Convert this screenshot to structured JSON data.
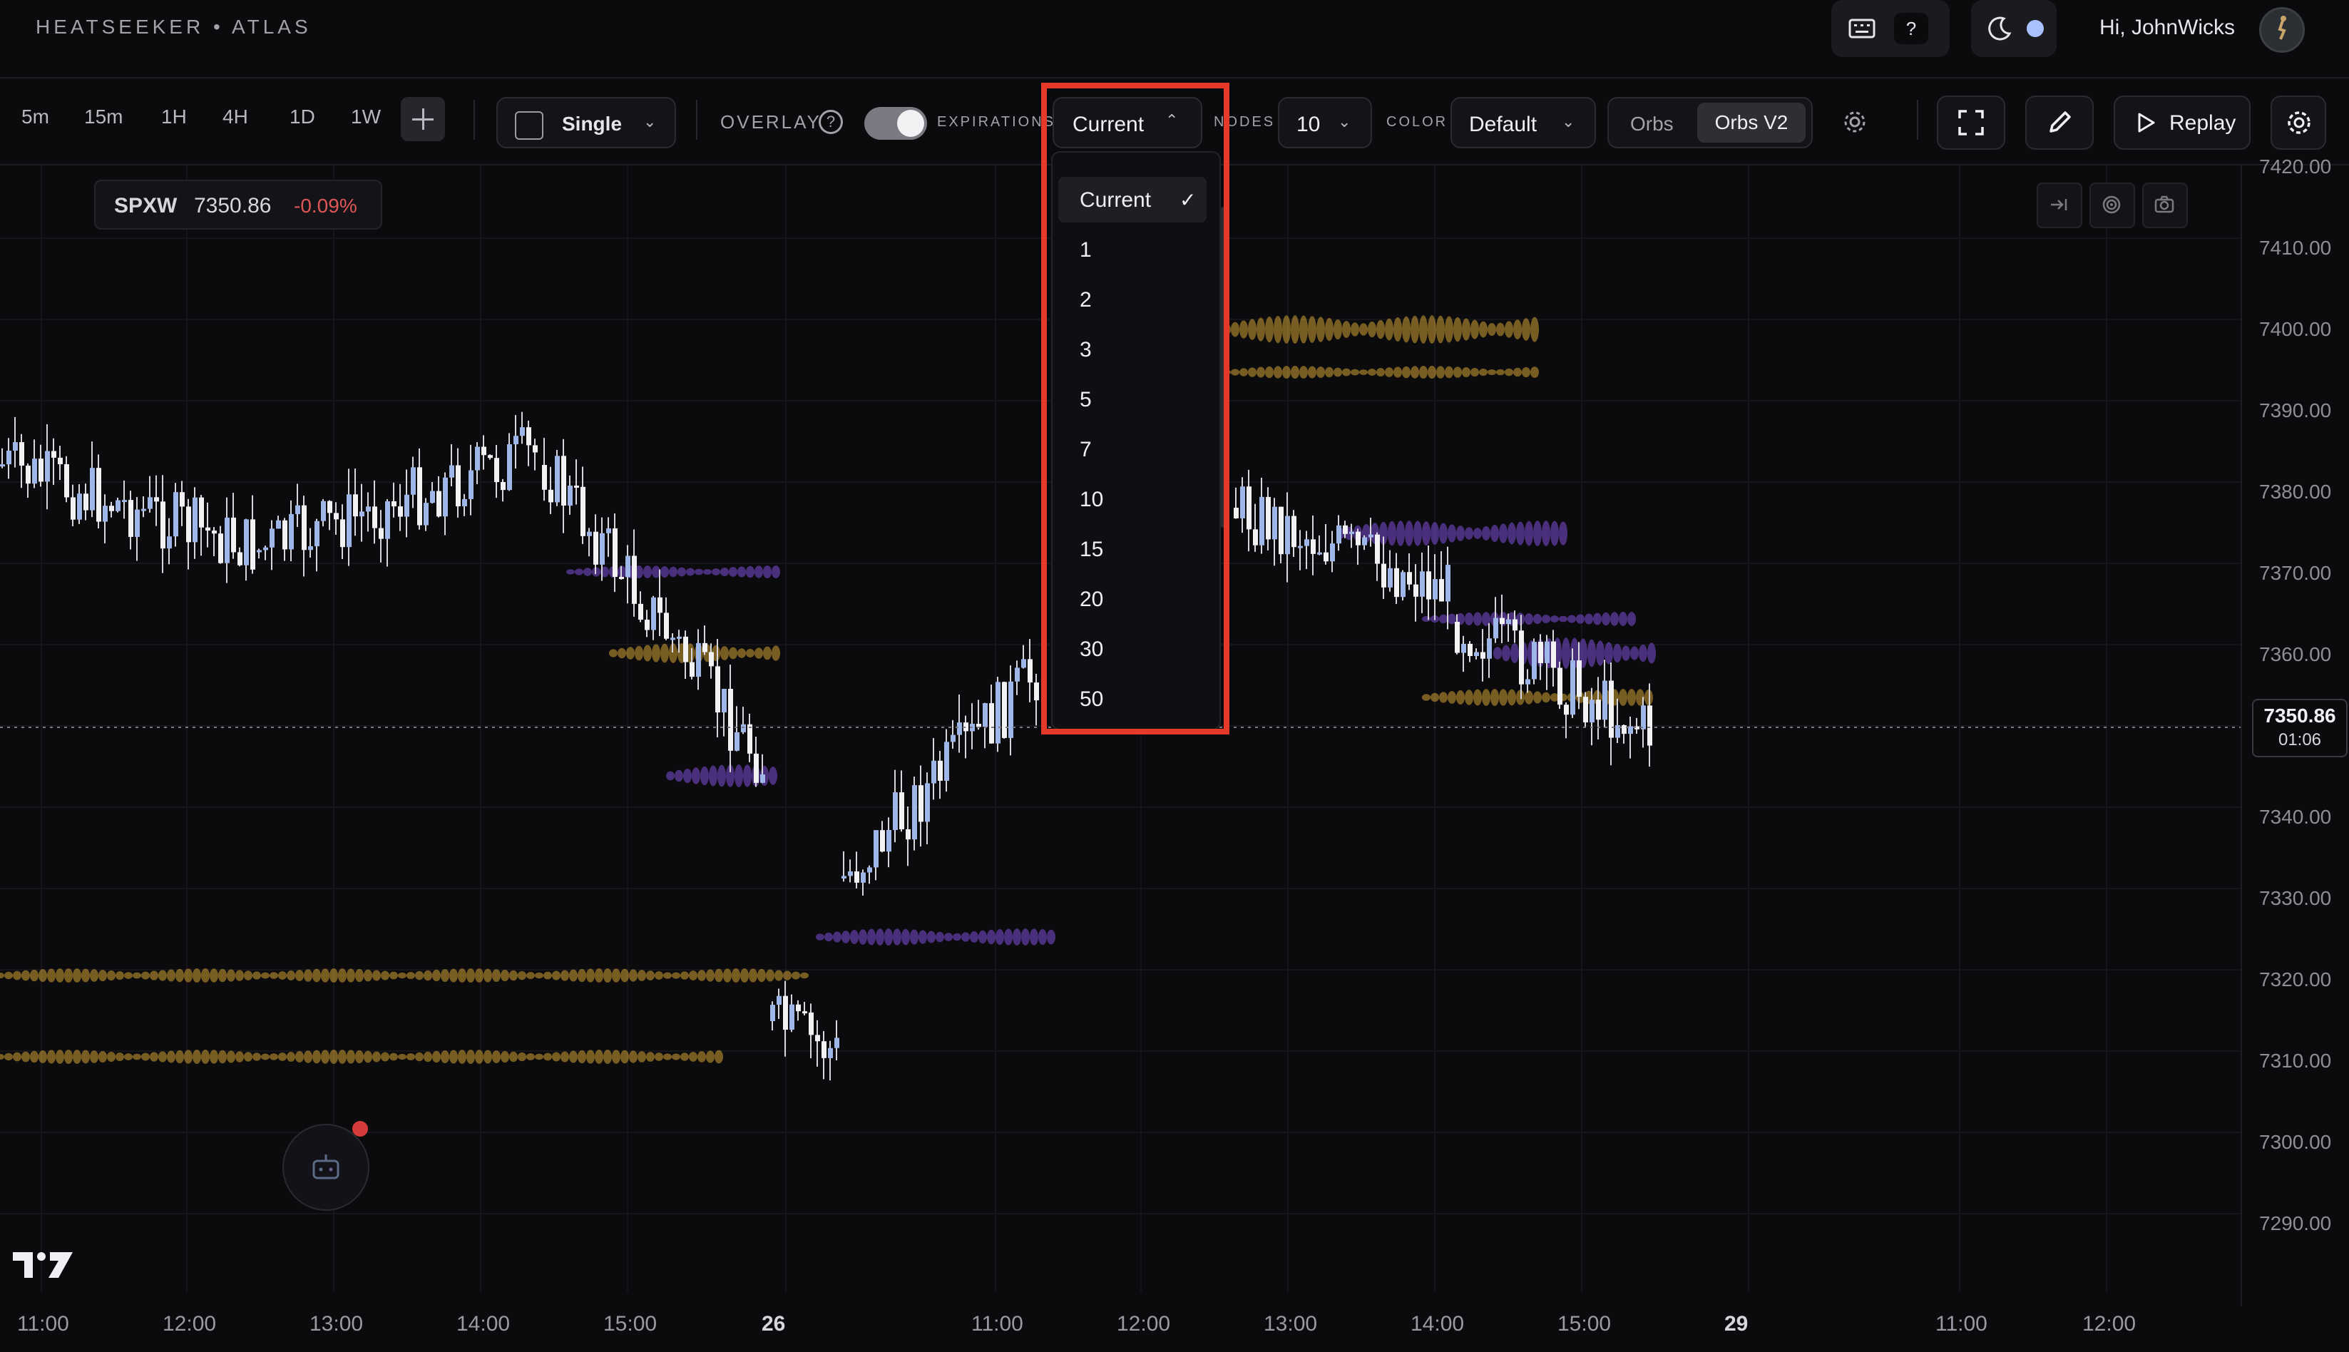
{
  "header": {
    "brand": "HEATSEEKER  •  ATLAS",
    "help_label": "?",
    "greeting": "Hi, JohnWicks",
    "theme_dot_color": "#a8c2ff"
  },
  "toolbar": {
    "timeframes": [
      "5m",
      "15m",
      "1H",
      "4H",
      "1D",
      "1W"
    ],
    "mode_label": "Single",
    "overlay_label": "OVERLAY",
    "expirations_label": "EXPIRATIONS",
    "expirations_value": "Current",
    "nodes_label": "NODES",
    "nodes_value": "10",
    "color_label": "COLOR",
    "color_value": "Default",
    "view_options": [
      "Orbs",
      "Orbs V2"
    ],
    "view_selected": "Orbs V2",
    "replay_label": "Replay"
  },
  "ticker": {
    "symbol": "SPXW",
    "price": "7350.86",
    "change": "-0.09%",
    "change_color": "#e05656"
  },
  "price_axis": {
    "labels": [
      "7420.00",
      "7410.00",
      "7400.00",
      "7390.00",
      "7380.00",
      "7370.00",
      "7360.00",
      "7340.00",
      "7330.00",
      "7320.00",
      "7310.00",
      "7300.00",
      "7290.00"
    ],
    "current_price": "7350.86",
    "countdown": "01:06"
  },
  "time_axis": {
    "labels": [
      "11:00",
      "12:00",
      "13:00",
      "14:00",
      "15:00",
      "26",
      "11:00",
      "12:00",
      "13:00",
      "14:00",
      "15:00",
      "29",
      "11:00",
      "12:00"
    ]
  },
  "expirations_menu": {
    "options": [
      "Current",
      "1",
      "2",
      "3",
      "5",
      "7",
      "10",
      "15",
      "20",
      "30",
      "50"
    ],
    "selected": "Current"
  },
  "colors": {
    "accent_highlight": "#e53a2a",
    "orb_gold": "#d4a236",
    "orb_purple": "#7e4fd8",
    "candle_up": "#9fb6e8",
    "candle_down": "#f2f2f4"
  }
}
